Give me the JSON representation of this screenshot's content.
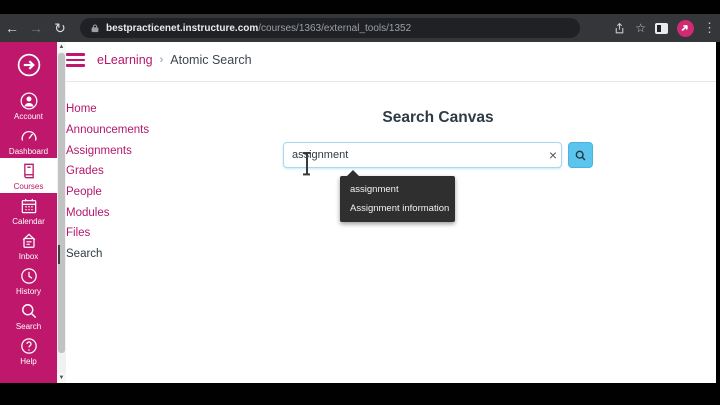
{
  "browser": {
    "back_icon": "←",
    "forward_icon": "→",
    "reload_icon": "↻",
    "url_domain": "bestpracticenet.instructure.com",
    "url_path": "/courses/1363/external_tools/1352",
    "star_icon": "☆",
    "dots_icon": "⋮"
  },
  "global_nav": {
    "items": [
      {
        "label": "Account",
        "icon": "account-icon",
        "active": false
      },
      {
        "label": "Dashboard",
        "icon": "dashboard-icon",
        "active": false
      },
      {
        "label": "Courses",
        "icon": "courses-icon",
        "active": true
      },
      {
        "label": "Calendar",
        "icon": "calendar-icon",
        "active": false
      },
      {
        "label": "Inbox",
        "icon": "inbox-icon",
        "active": false
      },
      {
        "label": "History",
        "icon": "history-icon",
        "active": false
      },
      {
        "label": "Search",
        "icon": "search-icon",
        "active": false
      },
      {
        "label": "Help",
        "icon": "help-icon",
        "active": false
      }
    ],
    "help_glyph": "?"
  },
  "breadcrumb": {
    "course": "eLearning",
    "separator": "›",
    "page": "Atomic Search"
  },
  "course_nav": {
    "items": [
      {
        "label": "Home",
        "active": false
      },
      {
        "label": "Announcements",
        "active": false
      },
      {
        "label": "Assignments",
        "active": false
      },
      {
        "label": "Grades",
        "active": false
      },
      {
        "label": "People",
        "active": false
      },
      {
        "label": "Modules",
        "active": false
      },
      {
        "label": "Files",
        "active": false
      },
      {
        "label": "Search",
        "active": true
      }
    ]
  },
  "main": {
    "title": "Search Canvas",
    "search_value": "assignment",
    "clear_icon": "×",
    "suggestions": [
      {
        "label": "assignment"
      },
      {
        "label": "Assignment information"
      }
    ]
  },
  "colors": {
    "brand_magenta": "#be176b",
    "search_button_blue": "#5cc5ee",
    "suggestion_bg": "#2f2f2f",
    "chrome_bar": "#34363a"
  }
}
